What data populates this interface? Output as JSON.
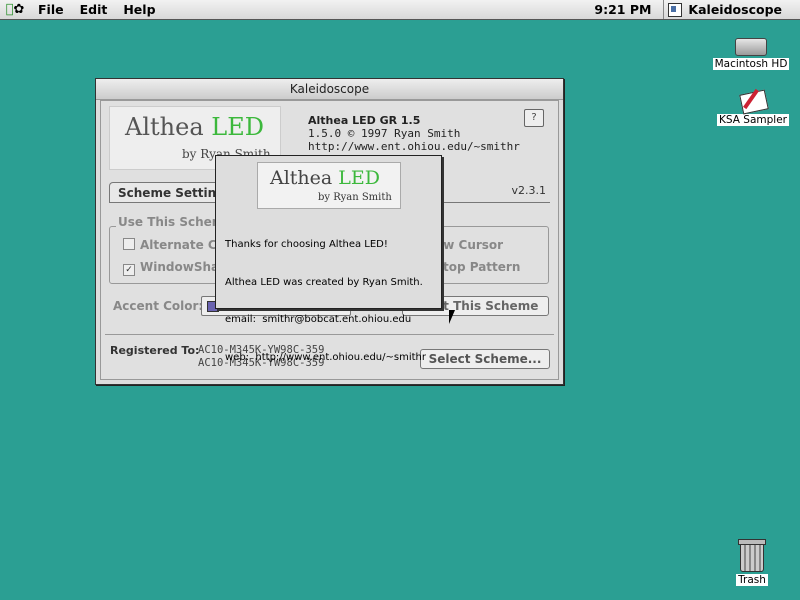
{
  "menubar": {
    "menus": [
      "File",
      "Edit",
      "Help"
    ],
    "clock": "9:21 PM",
    "app_name": "Kaleidoscope"
  },
  "desktop": {
    "icons": [
      {
        "label": "Macintosh HD",
        "icon": "hard-disk-icon"
      },
      {
        "label": "KSA Sampler",
        "icon": "sampler-doc-icon"
      },
      {
        "label": "Trash",
        "icon": "trash-icon"
      }
    ],
    "background_color": "#2b9f93"
  },
  "window": {
    "title": "Kaleidoscope",
    "logo_main": "Althea ",
    "logo_accent": "LED",
    "logo_sub": "by Ryan Smith",
    "scheme_name": "Althea LED GR 1.5",
    "scheme_copyright": "1.5.0 © 1997 Ryan Smith",
    "scheme_url": "http://www.ent.ohiou.edu/~smithr",
    "help_label": "?",
    "version": "v2.3.1",
    "tab_label": "Scheme Setting",
    "group_title": "Use This Scheme",
    "checkboxes": [
      {
        "label": "Alternate C",
        "checked": false
      },
      {
        "label": "WindowSha",
        "checked": true
      }
    ],
    "right_options": [
      "ow Cursor",
      "ktop Pattern"
    ],
    "accent_label": "Accent Color:",
    "about_button": "ut This Scheme",
    "registered_label": "Registered To:",
    "registration_codes": [
      "AC10-M345K-YW98C-359",
      "AC10-M345K-YW98C-359"
    ],
    "select_button": "Select Scheme..."
  },
  "about_dialog": {
    "logo_main": "Althea ",
    "logo_accent": "LED",
    "logo_sub": "by Ryan Smith",
    "lines": [
      "Thanks for choosing Althea LED!",
      "Althea LED was created by Ryan Smith.",
      "email:  smithr@bobcat.ent.ohiou.edu",
      "web:  http://www.ent.ohiou.edu/~smithr"
    ]
  }
}
